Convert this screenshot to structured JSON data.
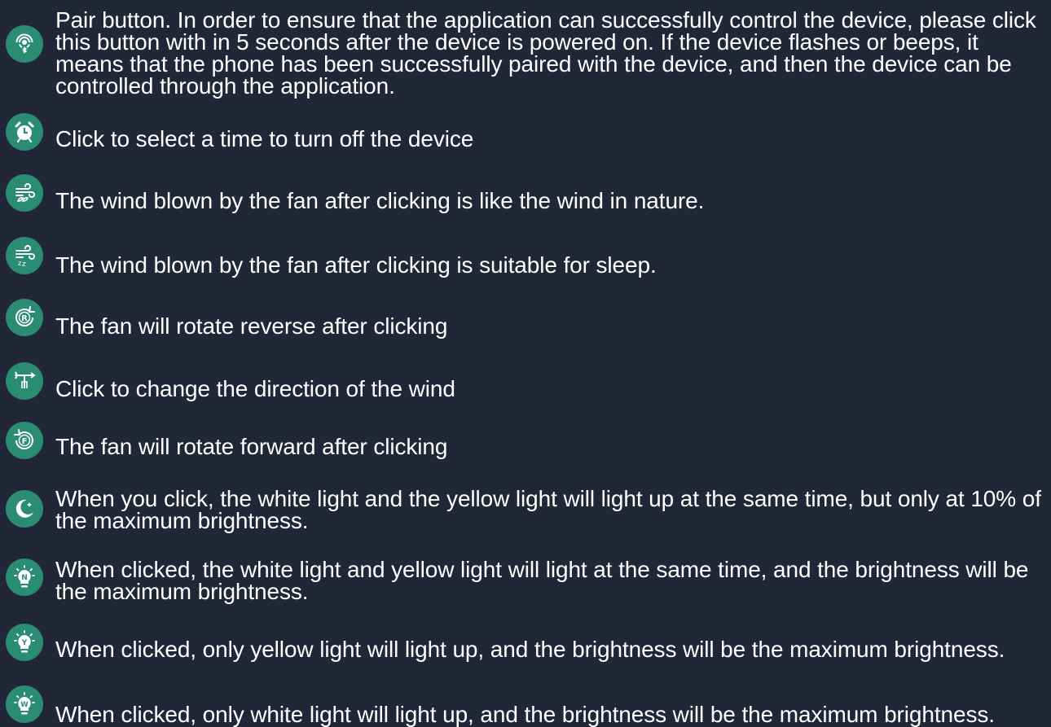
{
  "accent_color": "#2a8c72",
  "background_color": "#222738",
  "items": [
    {
      "icon": "pair-icon",
      "text": "Pair button. In order to ensure that the application can successfully control the device, please click this button with in 5 seconds after the device is powered on. If the device flashes or beeps, it means that the phone has been successfully paired with the device, and then the device can be controlled through the application."
    },
    {
      "icon": "alarm-clock-icon",
      "text": "Click to select a time to turn off the device"
    },
    {
      "icon": "natural-wind-icon",
      "text": "The wind blown by the fan after clicking is like the wind in nature."
    },
    {
      "icon": "sleep-wind-icon",
      "text": "The wind blown by the fan after clicking is suitable for sleep."
    },
    {
      "icon": "reverse-rotation-icon",
      "text": "The fan will rotate reverse after clicking"
    },
    {
      "icon": "wind-direction-icon",
      "text": "Click to change the direction of the wind"
    },
    {
      "icon": "forward-rotation-icon",
      "text": "The fan will rotate forward after clicking"
    },
    {
      "icon": "moon-night-light-icon",
      "text": "When you click, the white light and the yellow light will light up at the same time, but only at 10% of the maximum brightness."
    },
    {
      "icon": "bulb-n-icon",
      "text": "When clicked, the white light and yellow light will light at the same time, and the brightness will be the maximum brightness."
    },
    {
      "icon": "bulb-y-icon",
      "text": "When clicked, only yellow light will light up, and the brightness will be the maximum brightness."
    },
    {
      "icon": "bulb-w-icon",
      "text": "When clicked, only white light will light up, and the brightness will be the maximum brightness."
    }
  ],
  "icon_letters": {
    "reverse": "R",
    "forward": "F",
    "bulb_n": "N",
    "bulb_y": "Y",
    "bulb_w": "W"
  }
}
